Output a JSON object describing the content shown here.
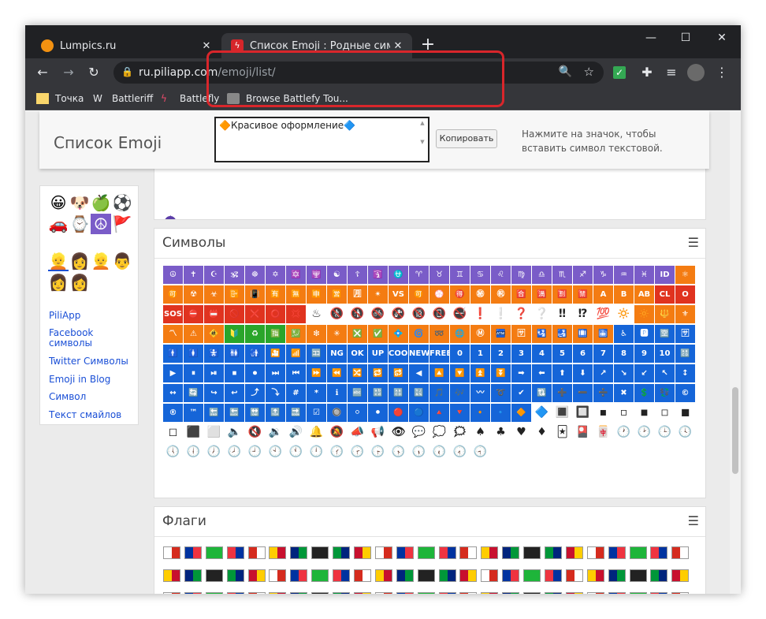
{
  "browser": {
    "tabs": [
      {
        "title": "Lumpics.ru",
        "active": false
      },
      {
        "title": "Список Emoji : Родные символ",
        "active": true
      }
    ],
    "new_tab": "+",
    "url": {
      "host": "ru.piliapp.com",
      "path": "/emoji/list/"
    },
    "bookmarks": [
      "Точка",
      "Battleriff",
      "Battlefly",
      "Browse Battlefy Tou..."
    ]
  },
  "page": {
    "title": "Список Emoji",
    "copy_field_text": "🔶Красивое оформление🔷",
    "copy_button": "Копировать",
    "hint": "Нажмите на значок, чтобы вставить символ текстовой.",
    "sidebar_links": [
      "PiliApp",
      "Facebook символы",
      "Twitter Символы",
      "Emoji in Blog",
      "Символ",
      "Текст смайлов"
    ],
    "sidebar_emoji_row1": [
      "😀",
      "🐶",
      "🍏",
      "⚽",
      "🚗",
      "⌚",
      "☮",
      "🚩"
    ],
    "sidebar_emoji_row2": [
      "👱",
      "👩",
      "👱",
      "👨",
      "👩",
      "👩"
    ]
  },
  "sections": {
    "symbols_title": "Символы",
    "flags_title": "Флаги",
    "menu_icon": "☰"
  },
  "symbols_rows": [
    [
      "☮",
      "✝",
      "☪",
      "🕉",
      "☸",
      "✡",
      "🔯",
      "🕎",
      "☯",
      "☦",
      "🛐",
      "⛎",
      "♈",
      "♉",
      "♊",
      "♋",
      "♌",
      "♍",
      "♎",
      "♏",
      "♐",
      "♑",
      "♒",
      "♓",
      "ID"
    ],
    [
      "⚛",
      "🉑",
      "☢",
      "☣",
      "📴",
      "📳",
      "🈶",
      "🈚",
      "🈸",
      "🈺",
      "🈷",
      "✴",
      "VS",
      "🉑",
      "💮",
      "🉐",
      "㊙",
      "㊗",
      "🈴",
      "🈵",
      "🈹",
      "🈲",
      "A",
      "B",
      "AB"
    ],
    [
      "CL",
      "O",
      "SOS",
      "⛔",
      "📛",
      "🚫",
      "❌",
      "⭕",
      "💢",
      "♨",
      "🚷",
      "🚯",
      "🚳",
      "🚱",
      "🔞",
      "📵",
      "🚭",
      "❗",
      "❕",
      "❓",
      "❔",
      "‼",
      "⁉",
      "💯",
      "🔅"
    ],
    [
      "🔆",
      "🔱",
      "⚜",
      "〽",
      "⚠",
      "🚸",
      "🔰",
      "♻",
      "🈯",
      "💹",
      "❇",
      "✳",
      "❎",
      "✅",
      "💠",
      "🌀",
      "➿",
      "🌐",
      "Ⓜ",
      "🏧",
      "🈂",
      "🛂",
      "🛃",
      "🛄",
      "🛅"
    ],
    [
      "♿",
      "🅿",
      "🈳",
      "🈂",
      "🚹",
      "🚺",
      "🚼",
      "🚻",
      "🚮",
      "🎦",
      "📶",
      "🈁",
      "NG",
      "OK",
      "UP",
      "COOL",
      "NEW",
      "FREE",
      "0",
      "1",
      "2",
      "3",
      "4",
      "5",
      "6"
    ],
    [
      "7",
      "8",
      "9",
      "10",
      "🔠",
      "▶",
      "⏸",
      "⏯",
      "⏹",
      "⏺",
      "⏭",
      "⏮",
      "⏩",
      "⏪",
      "🔀",
      "🔁",
      "🔂",
      "◀",
      "🔼",
      "🔽",
      "⏫",
      "⏬",
      "➡",
      "⬅",
      "⬆"
    ],
    [
      "⬇",
      "↗",
      "↘",
      "↙",
      "↖",
      "↕",
      "↔",
      "🔄",
      "↪",
      "↩",
      "⤴",
      "⤵",
      "#",
      "*",
      "ℹ",
      "🔤",
      "🔡",
      "🔠",
      "🔣",
      "🎵",
      "🎶",
      "〰",
      "➰",
      "✔",
      "🔃"
    ],
    [
      "➕",
      "➖",
      "➗",
      "✖",
      "💲",
      "💱",
      "©",
      "®",
      "™",
      "🔚",
      "🔙",
      "🔛",
      "🔝",
      "🔜",
      "☑",
      "🔘",
      "⚪",
      "⚫",
      "🔴",
      "🔵",
      "🔺",
      "🔻",
      "🔸",
      "🔹",
      "🔶"
    ],
    [
      "🔷",
      "🔳",
      "🔲",
      "▪",
      "▫",
      "◾",
      "◽",
      "◼",
      "◻",
      "⬛",
      "⬜",
      "🔈",
      "🔇",
      "🔉",
      "🔊",
      "🔔",
      "🔕",
      "📣",
      "📢",
      "👁",
      "💬",
      "💭",
      "🗯",
      "♠",
      "♣"
    ],
    [
      "♥",
      "♦",
      "🃏",
      "🎴",
      "🀄",
      "🕐",
      "🕑",
      "🕒",
      "🕓",
      "🕔",
      "🕕",
      "🕖",
      "🕗",
      "🕘",
      "🕙",
      "🕚",
      "🕛",
      "🕜",
      "🕝",
      "🕞",
      "🕟",
      "🕠",
      "🕡",
      "🕢",
      "🕣"
    ]
  ],
  "colors": {
    "purple": "#7a5cc8",
    "blue": "#1565d8",
    "red": "#e0331f",
    "orange": "#f47c12",
    "green": "#2aa52a",
    "black": "#222222",
    "highlight": "#d9262b"
  }
}
